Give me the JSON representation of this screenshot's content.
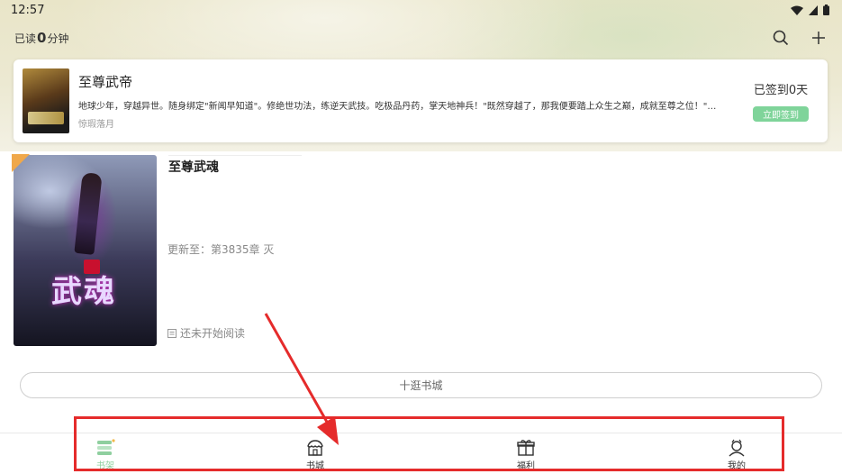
{
  "status_bar": {
    "time": "12:57",
    "icons": [
      "wifi-icon",
      "cellular-icon",
      "battery-icon"
    ]
  },
  "header": {
    "reading_prefix": "已读",
    "reading_minutes": "0",
    "reading_suffix": "分钟",
    "actions": [
      "search-icon",
      "plus-icon"
    ]
  },
  "recommend": {
    "title": "至尊武帝",
    "description": "地球少年，穿越异世。随身绑定\"新闻早知道\"。修绝世功法，练逆天武技。吃极品丹药，掌天地神兵！\"既然穿越了，那我便要踏上众生之巅，成就至尊之位！\"…",
    "author": "惊瑕落月",
    "sign_status": "已签到0天",
    "sign_button": "立即签到"
  },
  "shelf": {
    "books": [
      {
        "title": "至尊武魂",
        "update": "更新至：第3835章 灭",
        "progress": "还未开始阅读",
        "cover_logo": "武魂"
      }
    ],
    "browse_button": "十逛书城"
  },
  "bottom_nav": {
    "items": [
      {
        "label": "书架",
        "icon": "bookshelf-icon",
        "active": true
      },
      {
        "label": "书城",
        "icon": "store-icon",
        "active": false
      },
      {
        "label": "福利",
        "icon": "gift-icon",
        "active": false
      },
      {
        "label": "我的",
        "icon": "profile-icon",
        "active": false
      }
    ]
  },
  "colors": {
    "accent_green": "#7fd49a",
    "annotation_red": "#e52b2b",
    "tag_orange": "#f0a84a"
  }
}
